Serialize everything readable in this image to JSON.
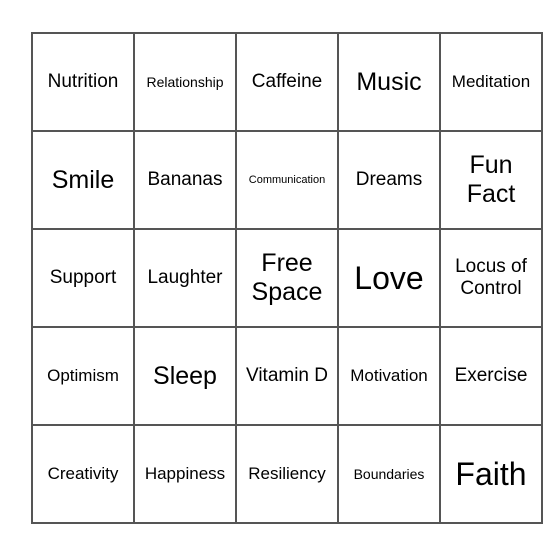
{
  "board": {
    "rows": [
      [
        {
          "text": "Nutrition",
          "size": "lg"
        },
        {
          "text": "Relationship",
          "size": "sm"
        },
        {
          "text": "Caffeine",
          "size": "lg"
        },
        {
          "text": "Music",
          "size": "xl"
        },
        {
          "text": "Meditation",
          "size": "md"
        }
      ],
      [
        {
          "text": "Smile",
          "size": "xl"
        },
        {
          "text": "Bananas",
          "size": "lg"
        },
        {
          "text": "Communication",
          "size": "xs"
        },
        {
          "text": "Dreams",
          "size": "lg"
        },
        {
          "text": "Fun Fact",
          "size": "xl"
        }
      ],
      [
        {
          "text": "Support",
          "size": "lg"
        },
        {
          "text": "Laughter",
          "size": "lg"
        },
        {
          "text": "Free Space",
          "size": "xl"
        },
        {
          "text": "Love",
          "size": "xxl"
        },
        {
          "text": "Locus of Control",
          "size": "lg"
        }
      ],
      [
        {
          "text": "Optimism",
          "size": "md"
        },
        {
          "text": "Sleep",
          "size": "xl"
        },
        {
          "text": "Vitamin D",
          "size": "lg"
        },
        {
          "text": "Motivation",
          "size": "md"
        },
        {
          "text": "Exercise",
          "size": "lg"
        }
      ],
      [
        {
          "text": "Creativity",
          "size": "md"
        },
        {
          "text": "Happiness",
          "size": "md"
        },
        {
          "text": "Resiliency",
          "size": "md"
        },
        {
          "text": "Boundaries",
          "size": "sm"
        },
        {
          "text": "Faith",
          "size": "xxl"
        }
      ]
    ]
  },
  "colors": {
    "grid_line": "#555555",
    "text": "#000000",
    "background": "#ffffff"
  }
}
